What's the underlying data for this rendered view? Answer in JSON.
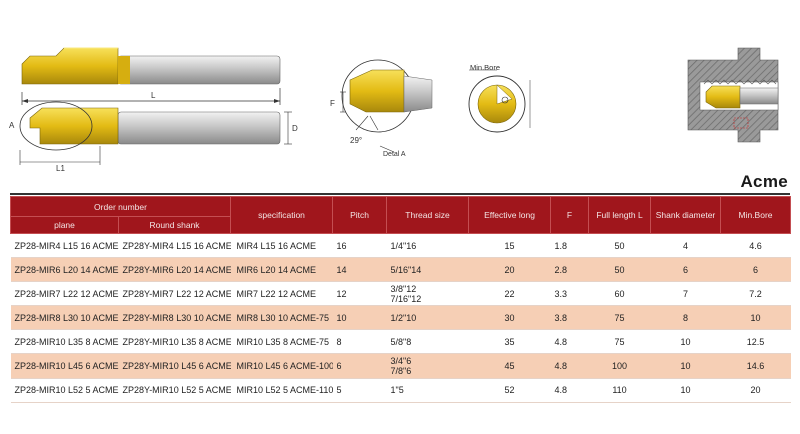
{
  "title": "Acme",
  "drawings": {
    "labels": {
      "L": "L",
      "A": "A",
      "D": "D",
      "L1": "L1",
      "F": "F",
      "angle": "29°",
      "detail": "Detal A",
      "min_bore": "Min.Bore"
    },
    "colors": {
      "gold": "#e8c21a",
      "gold_dark": "#a58a10",
      "steel": "#c9c9c9",
      "steel_dark": "#8e8e8e",
      "line": "#333333"
    }
  },
  "table": {
    "group_header": "Order number",
    "headers": {
      "plane": "plane",
      "round_shank": "Round shank",
      "specification": "specification",
      "pitch": "Pitch",
      "thread_size": "Thread size",
      "effective_long": "Effective long",
      "f": "F",
      "full_length": "Full length L",
      "shank_diameter": "Shank diameter",
      "min_bore": "Min.Bore"
    },
    "rows": [
      {
        "plane": "ZP28-MIR4 L15 16 ACME",
        "round": "ZP28Y-MIR4 L15 16 ACME",
        "spec": "MIR4 L15 16 ACME",
        "pitch": "16",
        "thread1": "1/4\"16",
        "thread2": "",
        "eff": "15",
        "f": "1.8",
        "full": "50",
        "shank": "4",
        "bore": "4.6"
      },
      {
        "plane": "ZP28-MIR6 L20 14 ACME",
        "round": "ZP28Y-MIR6 L20 14 ACME",
        "spec": "MIR6 L20 14 ACME",
        "pitch": "14",
        "thread1": "5/16\"14",
        "thread2": "",
        "eff": "20",
        "f": "2.8",
        "full": "50",
        "shank": "6",
        "bore": "6"
      },
      {
        "plane": "ZP28-MIR7 L22 12 ACME",
        "round": "ZP28Y-MIR7 L22 12 ACME",
        "spec": "MIR7 L22 12 ACME",
        "pitch": "12",
        "thread1": "3/8\"12",
        "thread2": "7/16\"12",
        "eff": "22",
        "f": "3.3",
        "full": "60",
        "shank": "7",
        "bore": "7.2"
      },
      {
        "plane": "ZP28-MIR8 L30 10 ACME",
        "round": "ZP28Y-MIR8 L30 10 ACME",
        "spec": "MIR8 L30 10 ACME-75",
        "pitch": "10",
        "thread1": "1/2\"10",
        "thread2": "",
        "eff": "30",
        "f": "3.8",
        "full": "75",
        "shank": "8",
        "bore": "10"
      },
      {
        "plane": "ZP28-MIR10 L35 8 ACME",
        "round": "ZP28Y-MIR10 L35 8 ACME",
        "spec": "MIR10 L35 8 ACME-75",
        "pitch": "8",
        "thread1": "5/8\"8",
        "thread2": "",
        "eff": "35",
        "f": "4.8",
        "full": "75",
        "shank": "10",
        "bore": "12.5"
      },
      {
        "plane": "ZP28-MIR10 L45 6 ACME",
        "round": "ZP28Y-MIR10 L45 6 ACME",
        "spec": "MIR10 L45 6 ACME-100",
        "pitch": "6",
        "thread1": "3/4\"6",
        "thread2": "7/8\"6",
        "eff": "45",
        "f": "4.8",
        "full": "100",
        "shank": "10",
        "bore": "14.6"
      },
      {
        "plane": "ZP28-MIR10 L52 5 ACME",
        "round": "ZP28Y-MIR10 L52 5 ACME",
        "spec": "MIR10 L52 5 ACME-110",
        "pitch": "5",
        "thread1": "1\"5",
        "thread2": "",
        "eff": "52",
        "f": "4.8",
        "full": "110",
        "shank": "10",
        "bore": "20"
      }
    ]
  }
}
